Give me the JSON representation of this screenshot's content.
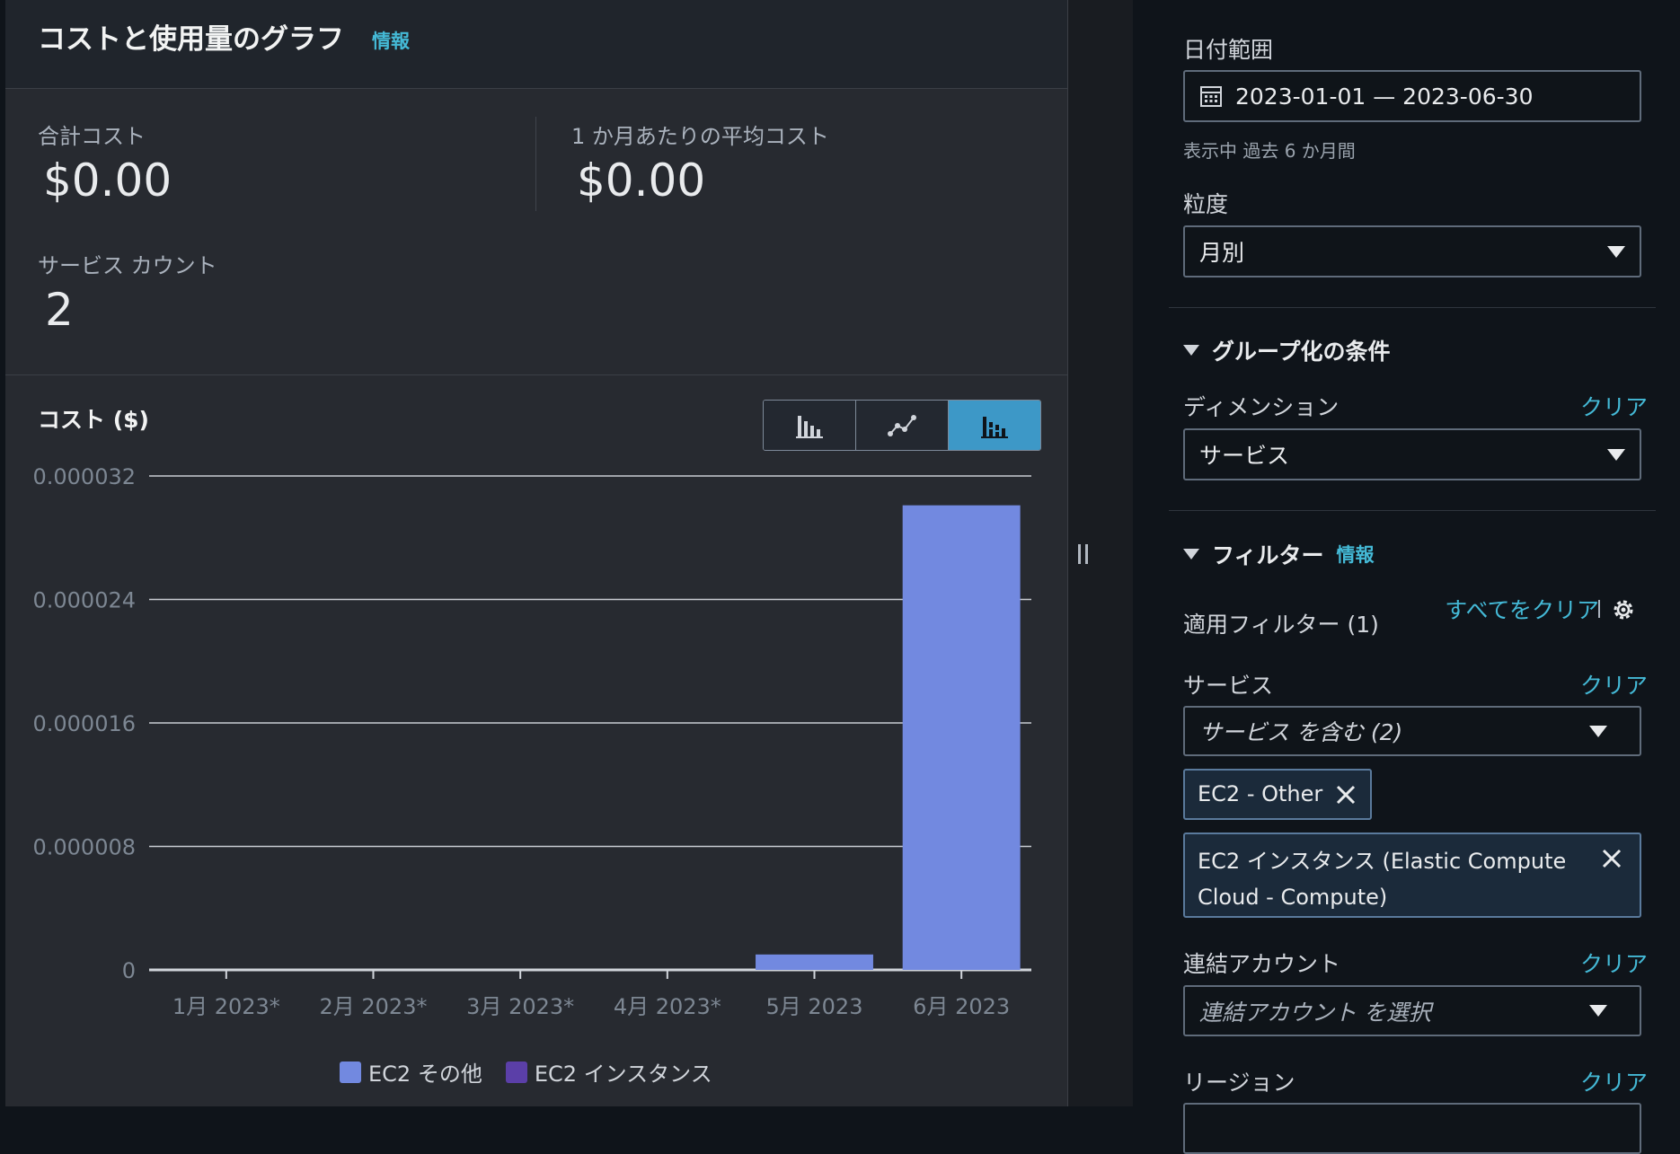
{
  "header": {
    "title": "コストと使用量のグラフ",
    "info": "情報"
  },
  "metrics": {
    "total_cost_label": "合計コスト",
    "total_cost_value": "$0.00",
    "avg_cost_label": "1 か月あたりの平均コスト",
    "avg_cost_value": "$0.00",
    "service_count_label": "サービス カウント",
    "service_count_value": "2"
  },
  "chart_section": {
    "title": "コスト ($)",
    "chart_type_buttons": [
      "bar-chart-icon",
      "line-chart-icon",
      "stacked-bar-chart-icon"
    ],
    "active_button": "stacked-bar-chart-icon"
  },
  "chart_data": {
    "type": "bar",
    "stacked": true,
    "categories": [
      "1月 2023*",
      "2月 2023*",
      "3月 2023*",
      "4月 2023*",
      "5月 2023",
      "6月 2023"
    ],
    "series": [
      {
        "name": "EC2 その他",
        "color": "#7289e0",
        "values": [
          0,
          0,
          0,
          0,
          1e-06,
          3.01e-05
        ]
      },
      {
        "name": "EC2 インスタンス",
        "color": "#5b3fa8",
        "values": [
          0,
          0,
          0,
          0,
          0,
          0
        ]
      }
    ],
    "y_ticks": [
      "0",
      "0.000008",
      "0.000016",
      "0.000024",
      "0.000032"
    ],
    "ylim": [
      0,
      3.2e-05
    ],
    "grid": true,
    "legend_position": "bottom"
  },
  "filters": {
    "date_range_label": "日付範囲",
    "date_range_value": "2023-01-01 — 2023-06-30",
    "date_range_hint": "表示中 過去 6 か月間",
    "granularity_label": "粒度",
    "granularity_value": "月別",
    "group_by_heading": "グループ化の条件",
    "dimension_label": "ディメンション",
    "dimension_clear": "クリア",
    "dimension_value": "サービス",
    "filter_heading": "フィルター",
    "filter_info": "情報",
    "applied_filters_label": "適用フィルター (1)",
    "clear_all": "すべてをクリア",
    "service_label": "サービス",
    "service_clear": "クリア",
    "service_value": "サービス を含む (2)",
    "tokens": [
      "EC2 - Other",
      "EC2 インスタンス (Elastic Compute Cloud - Compute)"
    ],
    "linked_account_label": "連結アカウント",
    "linked_account_clear": "クリア",
    "linked_account_placeholder": "連結アカウント を選択",
    "region_label": "リージョン",
    "region_clear": "クリア"
  }
}
